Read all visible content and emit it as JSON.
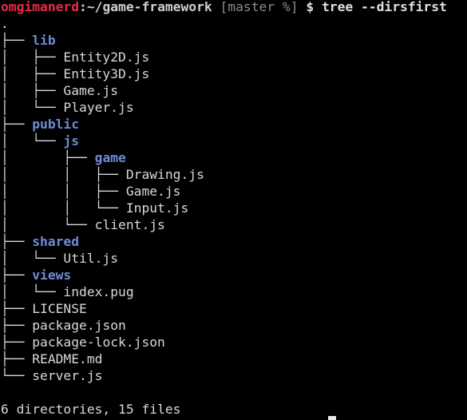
{
  "prompt": {
    "user_host": "omgimanerd",
    "separator": ":",
    "cwd": "~/game-framework",
    "git": "[master %]",
    "symbol": "$",
    "command": "tree --dirsfirst"
  },
  "tree": {
    "root": ".",
    "lines": [
      {
        "guide": "├── ",
        "name": "lib",
        "kind": "dir"
      },
      {
        "guide": "│   ├── ",
        "name": "Entity2D.js",
        "kind": "file"
      },
      {
        "guide": "│   ├── ",
        "name": "Entity3D.js",
        "kind": "file"
      },
      {
        "guide": "│   ├── ",
        "name": "Game.js",
        "kind": "file"
      },
      {
        "guide": "│   └── ",
        "name": "Player.js",
        "kind": "file"
      },
      {
        "guide": "├── ",
        "name": "public",
        "kind": "dir"
      },
      {
        "guide": "│   └── ",
        "name": "js",
        "kind": "dir"
      },
      {
        "guide": "│       ├── ",
        "name": "game",
        "kind": "dir"
      },
      {
        "guide": "│       │   ├── ",
        "name": "Drawing.js",
        "kind": "file"
      },
      {
        "guide": "│       │   ├── ",
        "name": "Game.js",
        "kind": "file"
      },
      {
        "guide": "│       │   └── ",
        "name": "Input.js",
        "kind": "file"
      },
      {
        "guide": "│       └── ",
        "name": "client.js",
        "kind": "file"
      },
      {
        "guide": "├── ",
        "name": "shared",
        "kind": "dir"
      },
      {
        "guide": "│   └── ",
        "name": "Util.js",
        "kind": "file"
      },
      {
        "guide": "├── ",
        "name": "views",
        "kind": "dir"
      },
      {
        "guide": "│   └── ",
        "name": "index.pug",
        "kind": "file"
      },
      {
        "guide": "├── ",
        "name": "LICENSE",
        "kind": "file"
      },
      {
        "guide": "├── ",
        "name": "package.json",
        "kind": "file"
      },
      {
        "guide": "├── ",
        "name": "package-lock.json",
        "kind": "file"
      },
      {
        "guide": "├── ",
        "name": "README.md",
        "kind": "file"
      },
      {
        "guide": "└── ",
        "name": "server.js",
        "kind": "file"
      }
    ],
    "summary": "6 directories, 15 files"
  }
}
